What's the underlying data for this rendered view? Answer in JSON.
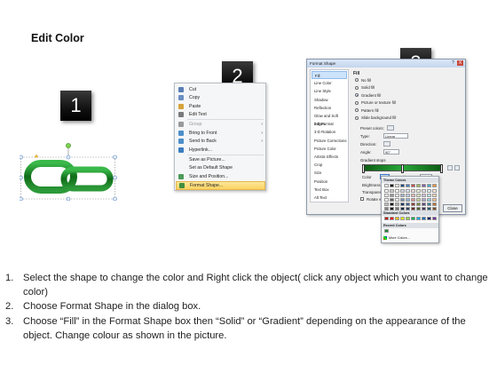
{
  "title": "Edit Color",
  "steps": [
    "1",
    "2",
    "3"
  ],
  "context_menu": {
    "items": [
      {
        "label": "Cut",
        "icon": "scissors-icon",
        "underline": "t"
      },
      {
        "label": "Copy",
        "icon": "copy-icon"
      },
      {
        "label": "Paste",
        "icon": "paste-icon"
      },
      {
        "label": "Edit Text",
        "icon": "edit-text-icon"
      },
      {
        "label": "Group",
        "icon": "group-icon",
        "submenu": true,
        "dim": true
      },
      {
        "label": "Bring to Front",
        "icon": "bring-front-icon",
        "submenu": true
      },
      {
        "label": "Send to Back",
        "icon": "send-back-icon",
        "submenu": true
      },
      {
        "label": "Hyperlink...",
        "icon": "hyperlink-icon"
      },
      {
        "label": "Save as Picture...",
        "icon": ""
      },
      {
        "label": "Set as Default Shape",
        "icon": ""
      },
      {
        "label": "Size and Position...",
        "icon": "size-position-icon"
      },
      {
        "label": "Format Shape...",
        "icon": "format-shape-icon",
        "highlighted": true
      }
    ]
  },
  "dialog": {
    "title": "Format Shape",
    "controls": {
      "help": "?",
      "close": "X"
    },
    "sidebar": [
      "Fill",
      "Line Color",
      "Line Style",
      "Shadow",
      "Reflection",
      "Glow and Soft Edges",
      "3-D Format",
      "3-D Rotation",
      "Picture Corrections",
      "Picture Color",
      "Artistic Effects",
      "Crop",
      "Size",
      "Position",
      "Text Box",
      "Alt Text"
    ],
    "fill_heading": "Fill",
    "fill_options": [
      {
        "label": "No fill",
        "selected": false
      },
      {
        "label": "Solid fill",
        "selected": false
      },
      {
        "label": "Gradient fill",
        "selected": true
      },
      {
        "label": "Picture or texture fill",
        "selected": false
      },
      {
        "label": "Pattern fill",
        "selected": false
      },
      {
        "label": "Slide background fill",
        "selected": false
      }
    ],
    "preset_colors_label": "Preset colors:",
    "type_label": "Type:",
    "type_value": "Linear",
    "direction_label": "Direction:",
    "angle_label": "Angle:",
    "angle_value": "90°",
    "gradient_stops_label": "Gradient stops",
    "color_label": "Color",
    "position_label": "Position:",
    "position_value": "1%",
    "brightness_label": "Brightness:",
    "transparency_label": "Transparency:",
    "rotate_label": "Rotate with shape",
    "close_button": "Close",
    "accent_color": "#1d8a2b"
  },
  "palette": {
    "theme_heading": "Theme Colors",
    "standard_heading": "Standard Colors",
    "recent_heading": "Recent Colors",
    "more_colors": "More Colors...",
    "theme_top": [
      "#ffffff",
      "#000000",
      "#eeece1",
      "#1f497d",
      "#4f81bd",
      "#c0504d",
      "#9bbb59",
      "#8064a2",
      "#4bacc6",
      "#f79646"
    ],
    "standard": [
      "#c00000",
      "#ff0000",
      "#ffc000",
      "#ffff00",
      "#92d050",
      "#00b050",
      "#00b0f0",
      "#0070c0",
      "#002060",
      "#7030a0"
    ],
    "recent": [
      "#1d8a2b"
    ]
  },
  "instructions": [
    {
      "num": "1.",
      "text": "Select the shape to change the color and Right click the object( click any object which you want to change color)"
    },
    {
      "num": "2.",
      "text": "Choose Format Shape in the dialog box."
    },
    {
      "num": "3.",
      "text": "Choose “Fill” in the Format Shape box then “Solid” or “Gradient” depending on the appearance of the object. Change colour as shown in the picture."
    }
  ]
}
